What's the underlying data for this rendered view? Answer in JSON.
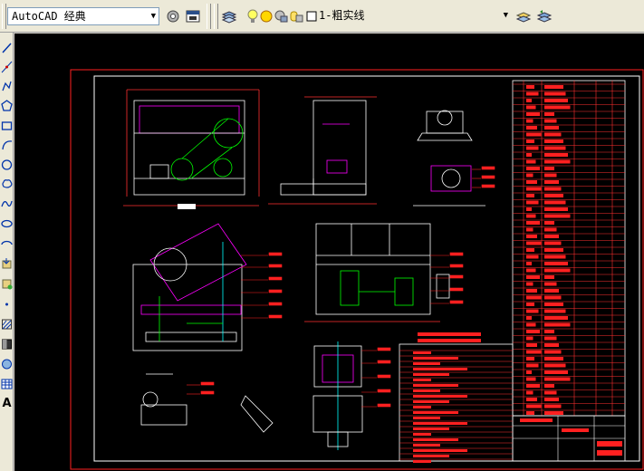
{
  "toolbar": {
    "workspace": "AutoCAD 经典",
    "layer": "1-粗实线",
    "icons": [
      "workspace-settings-icon",
      "workspace-toolbar-icon",
      "layer-manager-icon",
      "layer-on-icon",
      "layer-freeze-icon",
      "layer-lock-icon",
      "layer-color-icon",
      "make-current-icon",
      "layer-previous-icon"
    ]
  },
  "left_toolbar": {
    "icons": [
      "line-icon",
      "construction-line-icon",
      "polyline-icon",
      "polygon-icon",
      "rectangle-icon",
      "arc-icon",
      "circle-icon",
      "revision-cloud-icon",
      "spline-icon",
      "ellipse-icon",
      "ellipse-arc-icon",
      "insert-block-icon",
      "make-block-icon",
      "point-icon",
      "hatch-icon",
      "gradient-icon",
      "region-icon",
      "table-icon",
      "multiline-text-icon"
    ],
    "text_tool_label": "A"
  },
  "drawing": {
    "background": "#000000",
    "frame_color": "#ff2020",
    "line_color": "#ffffff",
    "accent_colors": [
      "#ff00ff",
      "#00ff00",
      "#00ffff",
      "#ffff00"
    ]
  }
}
